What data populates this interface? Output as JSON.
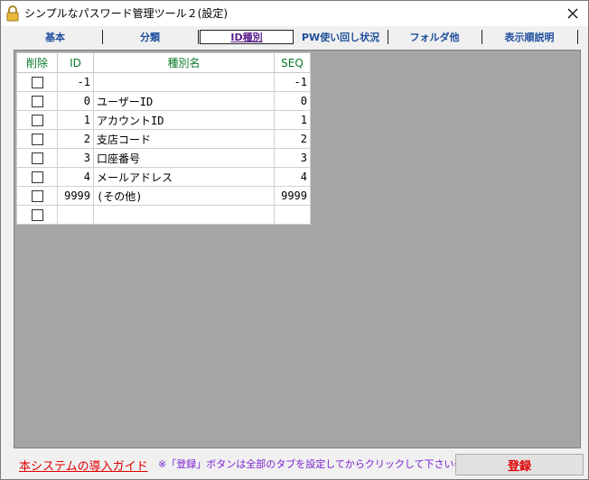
{
  "window": {
    "title": "シンプルなパスワード管理ツール２(設定)"
  },
  "tabs": [
    {
      "label": "基本"
    },
    {
      "label": "分類"
    },
    {
      "label": "ID種別"
    },
    {
      "label": "PW使い回し状況"
    },
    {
      "label": "フォルダ他"
    },
    {
      "label": "表示順説明"
    }
  ],
  "table": {
    "headers": [
      "削除",
      "ID",
      "種別名",
      "SEQ"
    ],
    "rows": [
      {
        "id": "-1",
        "name": "",
        "seq": "-1"
      },
      {
        "id": "0",
        "name": "ユーザーID",
        "seq": "0"
      },
      {
        "id": "1",
        "name": "アカウントID",
        "seq": "1"
      },
      {
        "id": "2",
        "name": "支店コード",
        "seq": "2"
      },
      {
        "id": "3",
        "name": "口座番号",
        "seq": "3"
      },
      {
        "id": "4",
        "name": "メールアドレス",
        "seq": "4"
      },
      {
        "id": "9999",
        "name": "(その他)",
        "seq": "9999"
      },
      {
        "id": "",
        "name": "",
        "seq": ""
      }
    ]
  },
  "footer": {
    "guide_link": "本システムの導入ガイド",
    "note": "※「登録」ボタンは全部のタブを設定してからクリックして下さい⇒",
    "register_label": "登録"
  },
  "colors": {
    "tab_text": "#1f4e9c",
    "active_tab_text": "#5a1e8c",
    "header_text": "#0a7a2a",
    "link_red": "#e00000",
    "note_purple": "#7a1fd1",
    "panel_bg": "#a5a5a5"
  },
  "icons": {
    "app": "lock-icon",
    "close": "close-icon"
  }
}
